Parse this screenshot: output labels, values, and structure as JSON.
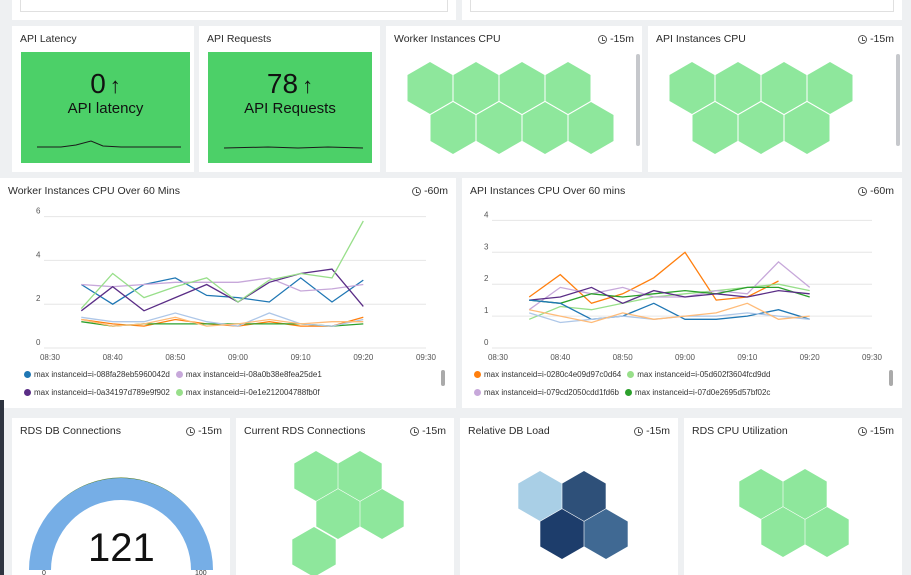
{
  "colors": {
    "green_bg": "#4cd068",
    "hex_green": "#8ee79c",
    "dark_navy": "#1d3d6b",
    "mid_navy": "#2e5079",
    "light_blue": "#a9cfe6",
    "steel": "#406993"
  },
  "panels": {
    "api_latency": {
      "title": "API Latency",
      "value": "0",
      "arrow": "↑",
      "subtitle": "API latency"
    },
    "api_requests": {
      "title": "API Requests",
      "value": "78",
      "arrow": "↑",
      "subtitle": "API Requests"
    },
    "worker_cpu": {
      "title": "Worker Instances CPU",
      "time": "-15m"
    },
    "api_cpu": {
      "title": "API Instances CPU",
      "time": "-15m"
    },
    "worker_cpu_60": {
      "title": "Worker Instances CPU Over 60 Mins",
      "time": "-60m"
    },
    "api_cpu_60": {
      "title": "API Instances CPU Over 60 mins",
      "time": "-60m"
    },
    "rds_connections": {
      "title": "RDS DB Connections",
      "time": "-15m",
      "value": "121",
      "min_label": "0",
      "max_label": "100"
    },
    "current_rds": {
      "title": "Current RDS Connections",
      "time": "-15m"
    },
    "relative_db_load": {
      "title": "Relative DB Load",
      "time": "-15m"
    },
    "rds_cpu": {
      "title": "RDS CPU Utilization",
      "time": "-15m"
    }
  },
  "chart_data": [
    {
      "type": "line",
      "title": "Worker Instances CPU Over 60 Mins",
      "x_ticks": [
        "08:30",
        "08:40",
        "08:50",
        "09:00",
        "09:10",
        "09:20",
        "09:30"
      ],
      "y_ticks": [
        "0",
        "2",
        "4",
        "6"
      ],
      "ylim": [
        0,
        6.3
      ],
      "x": [
        "08:35",
        "08:40",
        "08:45",
        "08:50",
        "08:55",
        "09:00",
        "09:05",
        "09:10",
        "09:15",
        "09:20"
      ],
      "series": [
        {
          "name": "max instanceid=i-088fa28eb5960042d",
          "color": "#1f77b4",
          "values": [
            2.9,
            2.0,
            2.9,
            3.2,
            2.4,
            2.3,
            2.1,
            3.2,
            2.1,
            3.1
          ]
        },
        {
          "name": "max instanceid=i-08a0b38e8fea25de1",
          "color": "#c7a8da",
          "values": [
            2.9,
            2.8,
            2.9,
            3.0,
            3.0,
            3.0,
            3.2,
            2.6,
            2.7,
            2.9
          ]
        },
        {
          "name": "max instanceid=i-0a34197d789e9f902",
          "color": "#5a2d86",
          "values": [
            1.7,
            2.8,
            1.7,
            2.3,
            2.9,
            2.1,
            3.0,
            3.4,
            3.6,
            1.9
          ]
        },
        {
          "name": "max instanceid=i-0e1e212004788fb0f",
          "color": "#98df8a",
          "values": [
            1.8,
            3.4,
            2.3,
            2.8,
            3.2,
            2.1,
            3.1,
            3.4,
            3.2,
            5.8
          ]
        },
        {
          "name": "",
          "color": "#ff7f0e",
          "values": [
            1.3,
            1.1,
            1.0,
            1.3,
            1.1,
            1.0,
            1.2,
            1.0,
            1.0,
            1.4
          ]
        },
        {
          "name": "",
          "color": "#2ca02c",
          "values": [
            1.2,
            1.0,
            1.1,
            1.1,
            1.1,
            1.1,
            1.1,
            1.1,
            1.0,
            1.1
          ]
        },
        {
          "name": "",
          "color": "#aec7e8",
          "values": [
            1.4,
            1.2,
            1.2,
            1.6,
            1.2,
            1.0,
            1.6,
            1.1,
            1.0,
            1.3
          ]
        },
        {
          "name": "",
          "color": "#ffbb78",
          "values": [
            1.3,
            1.0,
            1.1,
            1.4,
            1.0,
            1.1,
            1.3,
            1.1,
            1.2,
            1.2
          ]
        }
      ]
    },
    {
      "type": "line",
      "title": "API Instances CPU Over 60 mins",
      "x_ticks": [
        "08:30",
        "08:40",
        "08:50",
        "09:00",
        "09:10",
        "09:20",
        "09:30"
      ],
      "y_ticks": [
        "0",
        "1",
        "2",
        "3",
        "4"
      ],
      "ylim": [
        0,
        4.2
      ],
      "x": [
        "08:35",
        "08:40",
        "08:45",
        "08:50",
        "08:55",
        "09:00",
        "09:05",
        "09:10",
        "09:15",
        "09:20"
      ],
      "series": [
        {
          "name": "max instanceid=i-0280c4e09d97c0d64",
          "color": "#ff7f0e",
          "values": [
            1.6,
            2.3,
            1.4,
            1.7,
            2.2,
            3.0,
            1.5,
            1.6,
            2.1,
            null
          ]
        },
        {
          "name": "max instanceid=i-05d602f3604fcd9dd",
          "color": "#98df8a",
          "values": [
            0.9,
            1.3,
            1.2,
            1.4,
            1.6,
            1.7,
            1.8,
            1.9,
            2.0,
            1.8
          ]
        },
        {
          "name": "max instanceid=i-079cd2050cdd1fd6b",
          "color": "#c7a8da",
          "values": [
            1.2,
            1.9,
            1.7,
            1.9,
            1.6,
            1.6,
            1.8,
            1.7,
            2.7,
            1.9
          ]
        },
        {
          "name": "max instanceid=i-07d0e2695d57bf02c",
          "color": "#2ca02c",
          "values": [
            1.5,
            1.4,
            1.7,
            1.6,
            1.7,
            1.8,
            1.7,
            1.9,
            1.9,
            1.6
          ]
        },
        {
          "name": "",
          "color": "#5a2d86",
          "values": [
            1.5,
            1.6,
            1.9,
            1.4,
            1.8,
            1.6,
            1.7,
            1.6,
            1.8,
            1.7
          ]
        },
        {
          "name": "",
          "color": "#1f77b4",
          "values": [
            1.5,
            1.4,
            0.9,
            1.0,
            1.4,
            0.9,
            0.9,
            1.0,
            1.2,
            0.9
          ]
        },
        {
          "name": "",
          "color": "#aec7e8",
          "values": [
            1.1,
            0.8,
            0.9,
            1.0,
            0.9,
            1.0,
            1.0,
            1.1,
            1.0,
            0.9
          ]
        },
        {
          "name": "",
          "color": "#ffbb78",
          "values": [
            1.2,
            1.0,
            0.8,
            1.1,
            0.9,
            1.0,
            1.1,
            1.4,
            0.9,
            1.0
          ]
        }
      ]
    }
  ]
}
